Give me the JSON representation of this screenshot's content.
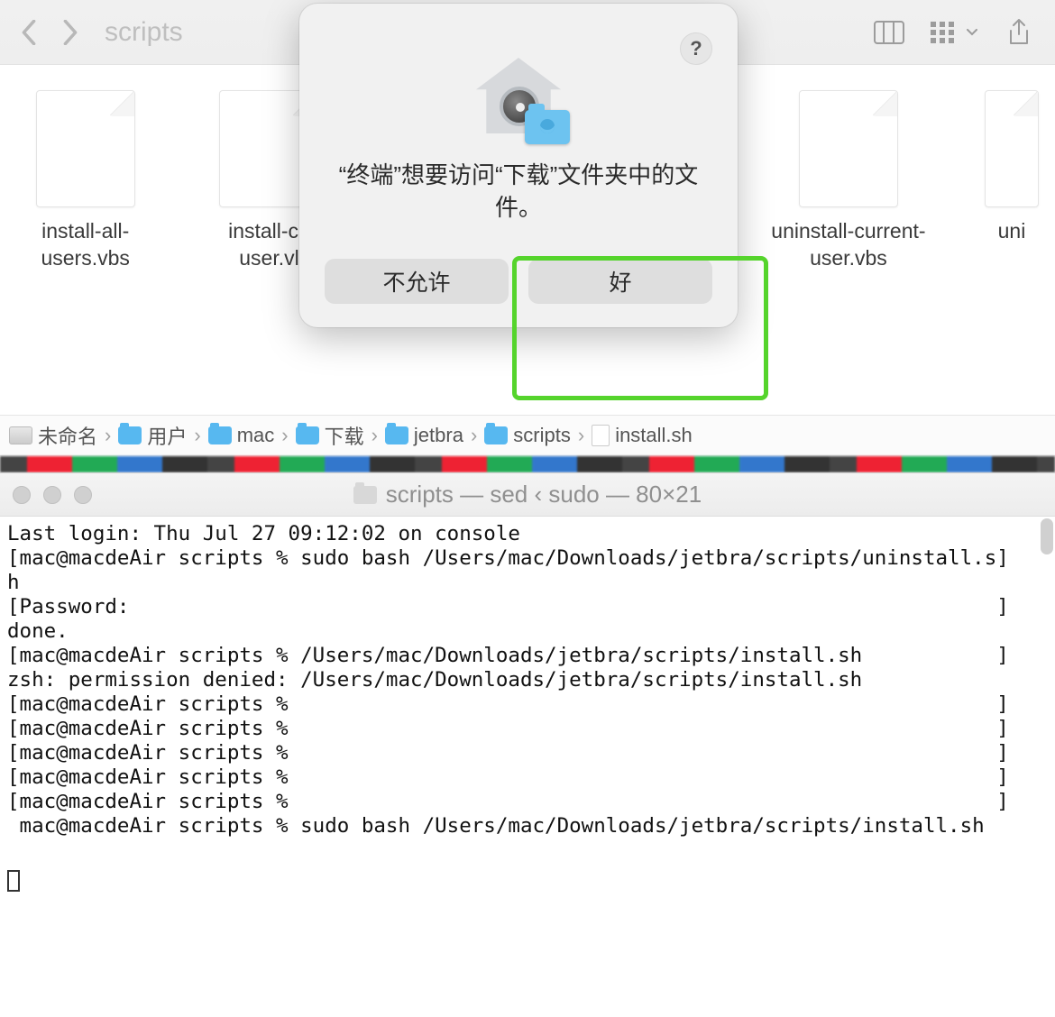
{
  "finder": {
    "title": "scripts",
    "files": [
      {
        "name": "install-all-users.vbs"
      },
      {
        "name": "install-current-user.vbs",
        "truncated": "install-cu\nuser.vl"
      },
      {
        "name": "uninstall-current-user.vbs"
      },
      {
        "name": "uninstall.sh",
        "truncated": "uni"
      }
    ],
    "path": [
      "未命名",
      "用户",
      "mac",
      "下载",
      "jetbra",
      "scripts",
      "install.sh"
    ]
  },
  "dialog": {
    "message": "“终端”想要访问“下载”文件夹中的文件。",
    "deny": "不允许",
    "allow": "好",
    "help": "?"
  },
  "terminal": {
    "title": "scripts — sed ‹ sudo — 80×21",
    "content": "Last login: Thu Jul 27 09:12:02 on console\n[mac@macdeAir scripts % sudo bash /Users/mac/Downloads/jetbra/scripts/uninstall.s]\nh\n[Password:                                                                       ]\ndone.\n[mac@macdeAir scripts % /Users/mac/Downloads/jetbra/scripts/install.sh           ]\nzsh: permission denied: /Users/mac/Downloads/jetbra/scripts/install.sh\n[mac@macdeAir scripts %                                                          ]\n[mac@macdeAir scripts %                                                          ]\n[mac@macdeAir scripts %                                                          ]\n[mac@macdeAir scripts %                                                          ]\n[mac@macdeAir scripts %                                                          ]\n mac@macdeAir scripts % sudo bash /Users/mac/Downloads/jetbra/scripts/install.sh\n"
  }
}
